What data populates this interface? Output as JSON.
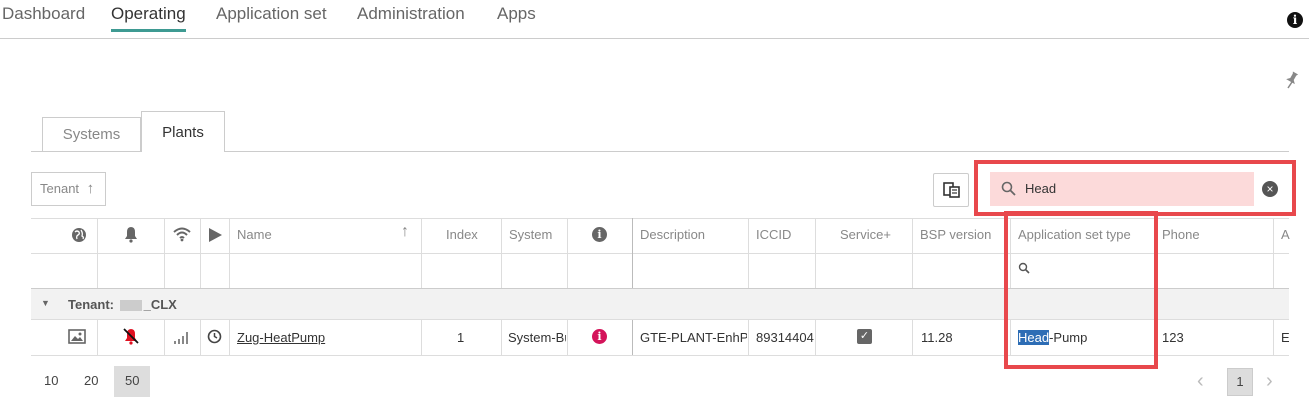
{
  "nav": {
    "items": [
      "Dashboard",
      "Operating",
      "Application set",
      "Administration",
      "Apps"
    ],
    "active": "Operating"
  },
  "tabs": [
    {
      "label": "Systems",
      "active": false
    },
    {
      "label": "Plants",
      "active": true
    }
  ],
  "toolbar": {
    "tenant_sort_label": "Tenant",
    "search_value": "Head"
  },
  "columns": [
    "Name",
    "Index",
    "System",
    "Description",
    "ICCID",
    "Service+",
    "BSP version",
    "Application set type",
    "Phone",
    "A"
  ],
  "group": {
    "label_prefix": "Tenant:",
    "label_suffix": "_CLX"
  },
  "rows": [
    {
      "name": "Zug-HeatPump",
      "index": "1",
      "system": "System-Bu",
      "description": "GTE-PLANT-EnhPriv",
      "iccid": "89314404",
      "service_plus": true,
      "bsp_version": "11.28",
      "application_set_type_match": "Head",
      "application_set_type_rest": "-Pump",
      "phone": "123",
      "extra": "E"
    }
  ],
  "pagination": {
    "sizes": [
      "10",
      "20",
      "50"
    ],
    "active_size": "50",
    "current_page": "1"
  },
  "colors": {
    "accent": "#3e9a92",
    "highlight": "#e8484c",
    "alarm": "#d4145a",
    "selection": "#2d6db5"
  }
}
